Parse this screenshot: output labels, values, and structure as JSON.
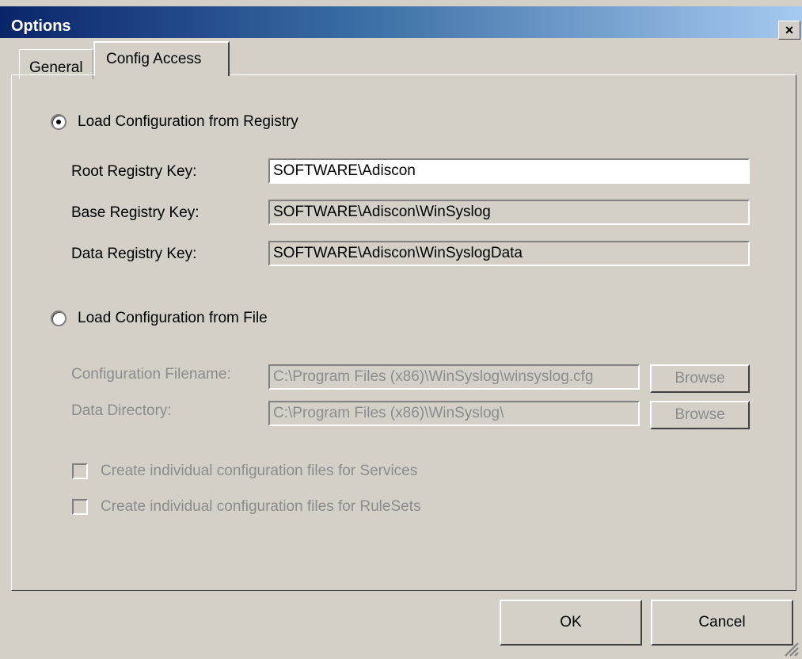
{
  "window": {
    "title": "Options",
    "close_glyph": "×"
  },
  "tabs": [
    {
      "label": "General",
      "active": false
    },
    {
      "label": "Config Access",
      "active": true
    }
  ],
  "registry": {
    "radio_label": "Load Configuration from Registry",
    "selected": true,
    "root_label": "Root Registry Key:",
    "root_value": "SOFTWARE\\Adiscon",
    "base_label": "Base Registry Key:",
    "base_value": "SOFTWARE\\Adiscon\\WinSyslog",
    "data_label": "Data Registry Key:",
    "data_value": "SOFTWARE\\Adiscon\\WinSyslogData"
  },
  "file": {
    "radio_label": "Load Configuration from File",
    "selected": false,
    "filename_label": "Configuration Filename:",
    "filename_value": "C:\\Program Files (x86)\\WinSyslog\\winsyslog.cfg",
    "datadir_label": "Data Directory:",
    "datadir_value": "C:\\Program Files (x86)\\WinSyslog\\",
    "browse_label": "Browse",
    "check_services": "Create individual configuration files for Services",
    "check_rulesets": "Create individual configuration files for RuleSets"
  },
  "footer": {
    "ok_label": "OK",
    "cancel_label": "Cancel"
  },
  "colors": {
    "face": "#d4d0c8",
    "title_start": "#0a246a",
    "title_end": "#a6caf0",
    "disabled_text": "#8c8c8c"
  }
}
